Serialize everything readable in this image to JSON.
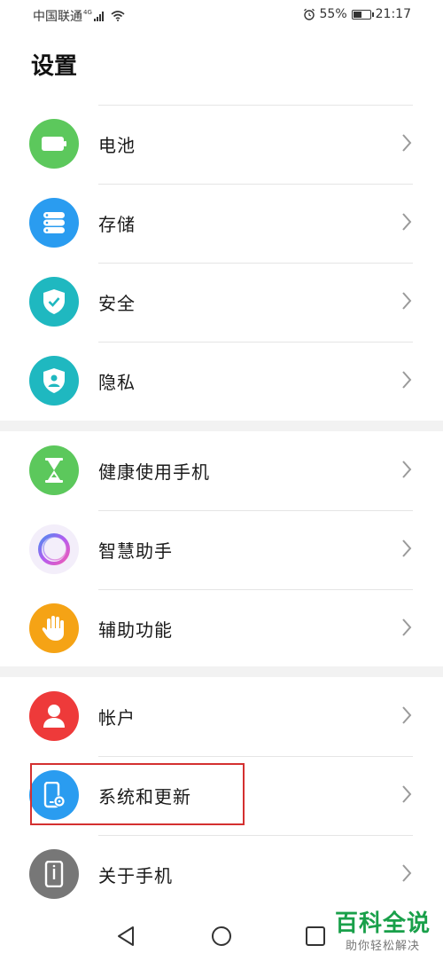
{
  "status_bar": {
    "carrier": "中国联通",
    "network_type": "4G",
    "battery_percent": "55%",
    "battery_level": 0.55,
    "time": "21:17"
  },
  "page_title": "设置",
  "groups": [
    {
      "items": [
        {
          "label": "电池",
          "icon": "battery-icon",
          "color": "#5cc85c"
        },
        {
          "label": "存储",
          "icon": "storage-icon",
          "color": "#2a9cf0"
        },
        {
          "label": "安全",
          "icon": "shield-check-icon",
          "color": "#1fb8c0"
        },
        {
          "label": "隐私",
          "icon": "privacy-shield-icon",
          "color": "#1fb8c0"
        }
      ]
    },
    {
      "items": [
        {
          "label": "健康使用手机",
          "icon": "hourglass-icon",
          "color": "#5cc85c"
        },
        {
          "label": "智慧助手",
          "icon": "assistant-ring-icon",
          "color": "#f3eefa"
        },
        {
          "label": "辅助功能",
          "icon": "hand-icon",
          "color": "#f5a315"
        }
      ]
    },
    {
      "items": [
        {
          "label": "帐户",
          "icon": "person-icon",
          "color": "#ee3a3a"
        },
        {
          "label": "系统和更新",
          "icon": "phone-gear-icon",
          "color": "#2a9cf0"
        },
        {
          "label": "关于手机",
          "icon": "phone-info-icon",
          "color": "#777777"
        }
      ]
    }
  ],
  "highlighted_item": "系统和更新",
  "watermark": {
    "main": "百科全说",
    "sub": "助你轻松解决"
  }
}
